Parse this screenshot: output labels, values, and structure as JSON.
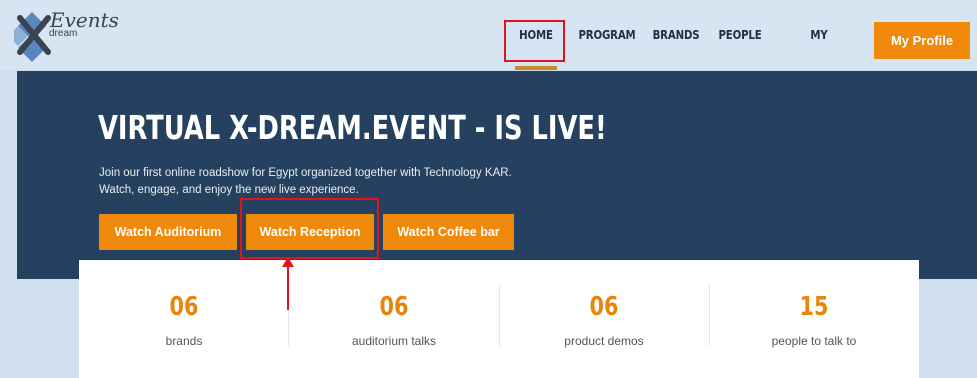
{
  "logo": {
    "text": "Events",
    "sub": "dream"
  },
  "nav": {
    "items": [
      "HOME",
      "PROGRAM",
      "BRANDS",
      "PEOPLE",
      "MY PROGRAM"
    ],
    "profile": "My Profile"
  },
  "hero": {
    "title": "VIRTUAL X-DREAM.EVENT - IS LIVE!",
    "line1": "Join our first online roadshow for Egypt organized together with Technology KAR.",
    "line2": "Watch, engage, and enjoy the new live experience.",
    "buttons": [
      "Watch Auditorium",
      "Watch Reception",
      "Watch Coffee bar"
    ]
  },
  "stats": [
    {
      "num": "06",
      "label": "brands"
    },
    {
      "num": "06",
      "label": "auditorium talks"
    },
    {
      "num": "06",
      "label": "product demos"
    },
    {
      "num": "15",
      "label": "people to talk to"
    }
  ],
  "colors": {
    "accent": "#f0880a",
    "hero": "#26415f",
    "highlight": "#e0141b"
  }
}
